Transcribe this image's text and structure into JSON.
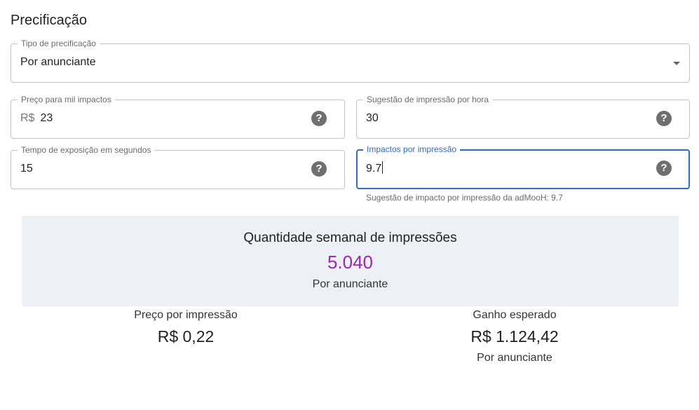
{
  "section_title": "Precificação",
  "pricing_type": {
    "label": "Tipo de precificação",
    "value": "Por anunciante"
  },
  "cpm": {
    "label": "Preço para mil impactos",
    "prefix": "R$",
    "value": "23"
  },
  "hourly_suggestion": {
    "label": "Sugestão de impressão por hora",
    "value": "30"
  },
  "exposure_time": {
    "label": "Tempo de exposição em segundos",
    "value": "15"
  },
  "impacts_per_impression": {
    "label": "Impactos por impressão",
    "value": "9.7",
    "helper": "Sugestão de impacto por impressão da adMooH: 9.7"
  },
  "help_icon_glyph": "?",
  "weekly": {
    "title": "Quantidade semanal de impressões",
    "value": "5.040",
    "subtitle": "Por anunciante"
  },
  "price_per_impression": {
    "label": "Preço por impressão",
    "value": "R$ 0,22"
  },
  "expected_gain": {
    "label": "Ganho esperado",
    "value": "R$ 1.124,42",
    "subtitle": "Por anunciante"
  },
  "colors": {
    "accent": "#2f6cc5",
    "highlight": "#9c27b0",
    "summary_bg": "#edf0f4"
  }
}
